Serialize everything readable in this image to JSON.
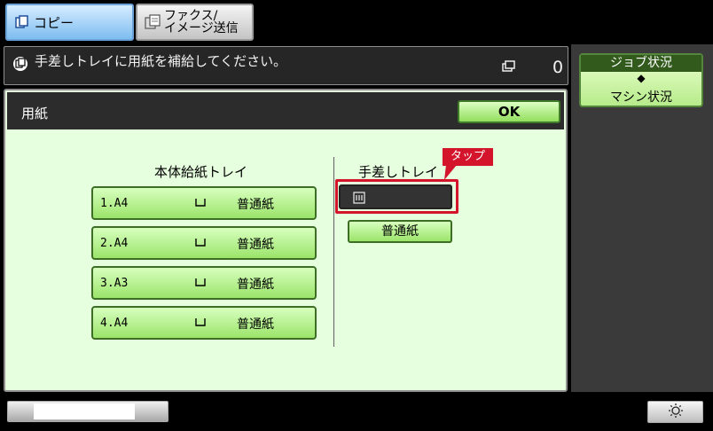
{
  "tabs": [
    {
      "label": "コピー",
      "active": true,
      "icon": "copy-icon"
    },
    {
      "label_line1": "ファクス/",
      "label_line2": "イメージ送信",
      "active": false,
      "icon": "fax-icon"
    }
  ],
  "message": {
    "text": "手差しトレイに用紙を補給してください。",
    "count": "0"
  },
  "side": {
    "job_status": "ジョブ状況",
    "machine_status": "マシン状況"
  },
  "dialog": {
    "title": "用紙",
    "ok_label": "OK"
  },
  "main_tray": {
    "title": "本体給紙トレイ",
    "trays": [
      {
        "number": "1.A4",
        "type": "普通紙"
      },
      {
        "number": "2.A4",
        "type": "普通紙"
      },
      {
        "number": "3.A3",
        "type": "普通紙"
      },
      {
        "number": "4.A4",
        "type": "普通紙"
      }
    ]
  },
  "bypass": {
    "title": "手差しトレイ",
    "type": "普通紙"
  },
  "annotation": {
    "tap_label": "タップ",
    "color": "#d3142a"
  },
  "colors": {
    "button_green": "#9be46a",
    "active_tab_blue": "#7dbdf0",
    "dialog_bg": "#e6ffdf"
  }
}
